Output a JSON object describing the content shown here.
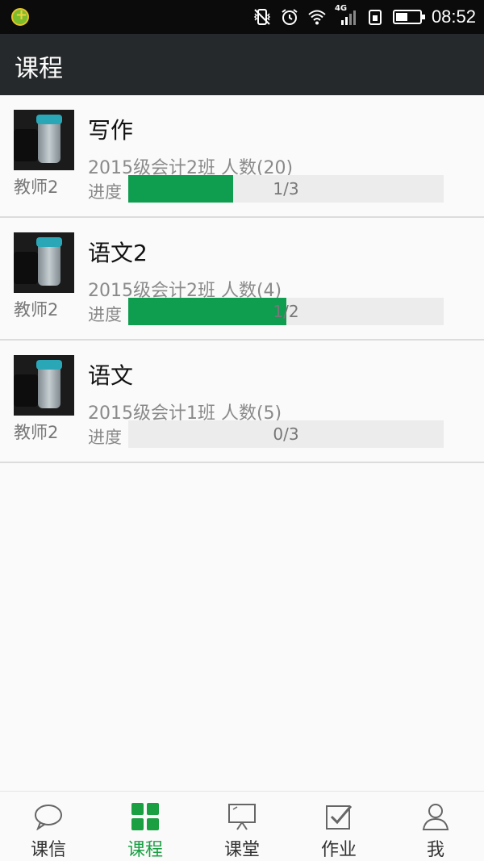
{
  "statusbar": {
    "time": "08:52",
    "network": "4G"
  },
  "header": {
    "title": "课程"
  },
  "courses": [
    {
      "name": "写作",
      "teacher": "教师2",
      "meta": "2015级会计2班 人数(20)",
      "progress_label": "进度",
      "progress_text": "1/3",
      "progress_value": 0.3333
    },
    {
      "name": "语文2",
      "teacher": "教师2",
      "meta": "2015级会计2班 人数(4)",
      "progress_label": "进度",
      "progress_text": "1/2",
      "progress_value": 0.5
    },
    {
      "name": "语文",
      "teacher": "教师2",
      "meta": "2015级会计1班 人数(5)",
      "progress_label": "进度",
      "progress_text": "0/3",
      "progress_value": 0
    }
  ],
  "nav": {
    "items": [
      {
        "label": "课信",
        "icon": "chat-bubble-icon"
      },
      {
        "label": "课程",
        "icon": "grid-icon"
      },
      {
        "label": "课堂",
        "icon": "presentation-board-icon"
      },
      {
        "label": "作业",
        "icon": "checkbox-edit-icon"
      },
      {
        "label": "我",
        "icon": "user-icon"
      }
    ],
    "active_index": 1,
    "active_color": "#1aa043",
    "inactive_color": "#666666"
  },
  "colors": {
    "progress_fill": "#0f9d50",
    "header_bg": "#26292b"
  }
}
